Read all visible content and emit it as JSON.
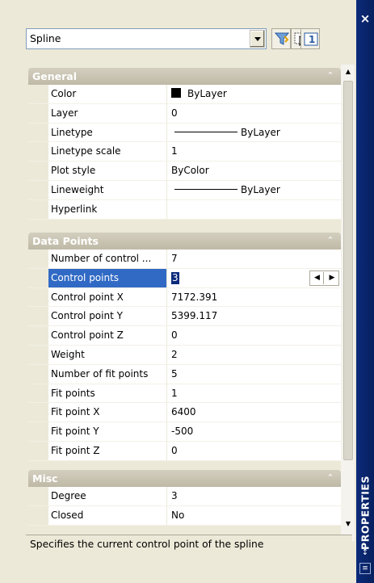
{
  "window": {
    "title": "PROPERTIES",
    "close_label": "×"
  },
  "selector": {
    "value": "Spline",
    "buttons": [
      "quick-select",
      "select-objects",
      "toggle-pickadd"
    ]
  },
  "sections": {
    "general": {
      "title": "General",
      "rows": [
        {
          "name": "Color",
          "value": "ByLayer"
        },
        {
          "name": "Layer",
          "value": "0"
        },
        {
          "name": "Linetype",
          "value": "ByLayer"
        },
        {
          "name": "Linetype scale",
          "value": "1"
        },
        {
          "name": "Plot style",
          "value": "ByColor"
        },
        {
          "name": "Lineweight",
          "value": "ByLayer"
        },
        {
          "name": "Hyperlink",
          "value": ""
        }
      ]
    },
    "data_points": {
      "title": "Data Points",
      "rows": [
        {
          "name": "Number of control ...",
          "value": "7"
        },
        {
          "name": "Control points",
          "value": "3"
        },
        {
          "name": "Control point X",
          "value": "7172.391"
        },
        {
          "name": "Control point Y",
          "value": "5399.117"
        },
        {
          "name": "Control point Z",
          "value": "0"
        },
        {
          "name": "Weight",
          "value": "2"
        },
        {
          "name": "Number of fit points",
          "value": "5"
        },
        {
          "name": "Fit points",
          "value": "1"
        },
        {
          "name": "Fit point X",
          "value": "6400"
        },
        {
          "name": "Fit point Y",
          "value": "-500"
        },
        {
          "name": "Fit point Z",
          "value": "0"
        }
      ]
    },
    "misc": {
      "title": "Misc",
      "rows": [
        {
          "name": "Degree",
          "value": "3"
        },
        {
          "name": "Closed",
          "value": "No"
        }
      ]
    }
  },
  "description": "Specifies the current control point of the spline",
  "colors": {
    "titlebar": "#0a246a",
    "selected_row": "#316ac5",
    "section_header": "#c9c4b3"
  }
}
